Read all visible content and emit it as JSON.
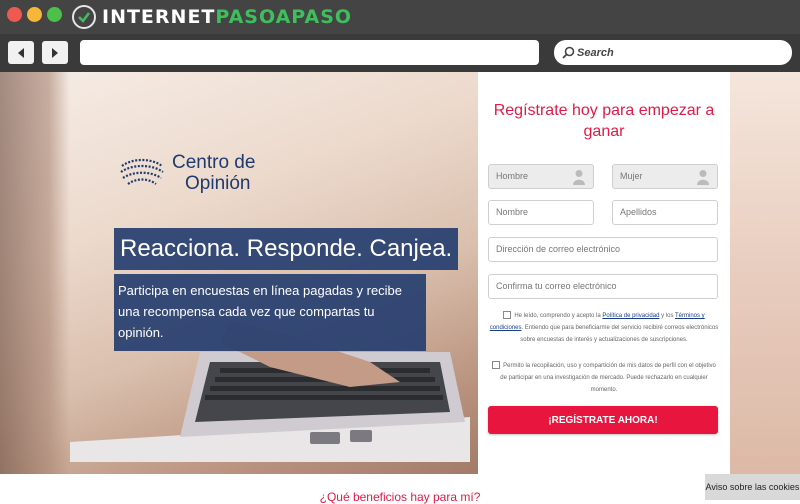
{
  "site": {
    "brand_part1": "INTERNET",
    "brand_part2": "PASOAPASO"
  },
  "browser": {
    "search_label": "Search",
    "url": ""
  },
  "hero": {
    "logo_line1": "Centro de",
    "logo_line2": "Opinión",
    "headline": "Reacciona. Responde. Canjea.",
    "subtext": "Participa en encuestas en línea pagadas y recibe una recompensa cada vez que compartas tu opinión."
  },
  "form": {
    "title": "Regístrate hoy para empezar a ganar",
    "hombre": "Hombre",
    "mujer": "Mujer",
    "nombre": "Nombre",
    "apellidos": "Apellidos",
    "email": "Dirección de correo electrónico",
    "email_confirm": "Confirma tu correo electrónico",
    "consent1_a": "He leído, comprendo y acepto la ",
    "privacy_link": "Política de privacidad",
    "consent1_b": " y los ",
    "terms_link": "Términos y condiciones",
    "consent1_c": ". Entiendo que para beneficiarme del servicio recibiré correos electrónicos sobre encuestas de interés y actualizaciones de suscripciones.",
    "consent2": "Permito la recopilación, uso y compartición de mis datos de perfil con el objetivo de participar en una investigación de mercado. Puede rechazarlo en cualquier momento.",
    "submit": "¡REGÍSTRATE AHORA!"
  },
  "footer": {
    "benefits": "¿Qué beneficios hay para mí?",
    "cookies": "Aviso sobre las cookies"
  },
  "colors": {
    "accent": "#e01b48",
    "brand_blue": "#263e70",
    "brand_green": "#3fbf5c"
  }
}
